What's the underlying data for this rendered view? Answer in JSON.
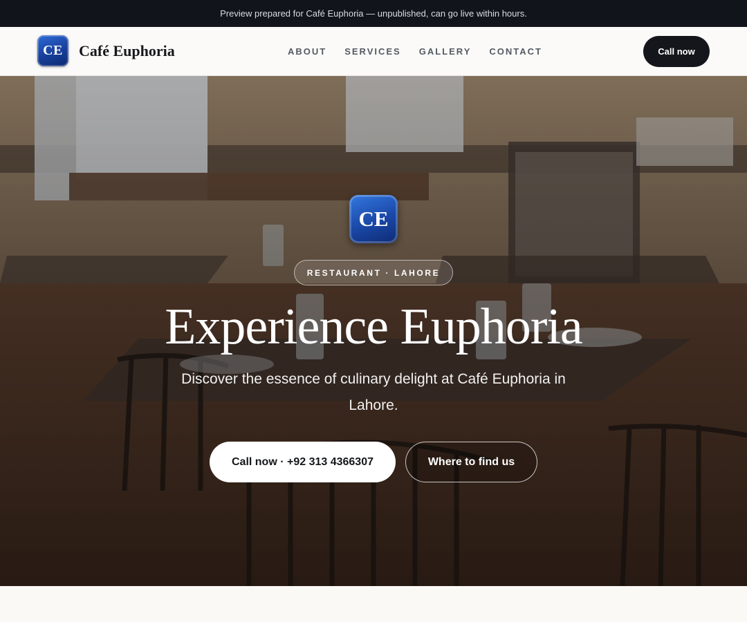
{
  "announcement": "Preview prepared for Café Euphoria — unpublished, can go live within hours.",
  "brand": {
    "monogram": "CE",
    "name": "Café Euphoria"
  },
  "nav": {
    "items": [
      {
        "label": "ABOUT"
      },
      {
        "label": "SERVICES"
      },
      {
        "label": "GALLERY"
      },
      {
        "label": "CONTACT"
      }
    ],
    "cta_label": "Call now"
  },
  "hero": {
    "monogram": "CE",
    "badge": "RESTAURANT · LAHORE",
    "title": "Experience Euphoria",
    "subtitle": "Discover the essence of culinary delight at Café Euphoria in Lahore.",
    "primary_button": "Call now · +92 313 4366307",
    "secondary_button": "Where to find us",
    "background": "restaurant-interior-photo"
  },
  "colors": {
    "accent": "#1a47a6",
    "dark": "#14161b",
    "topbar": "#11141a"
  }
}
